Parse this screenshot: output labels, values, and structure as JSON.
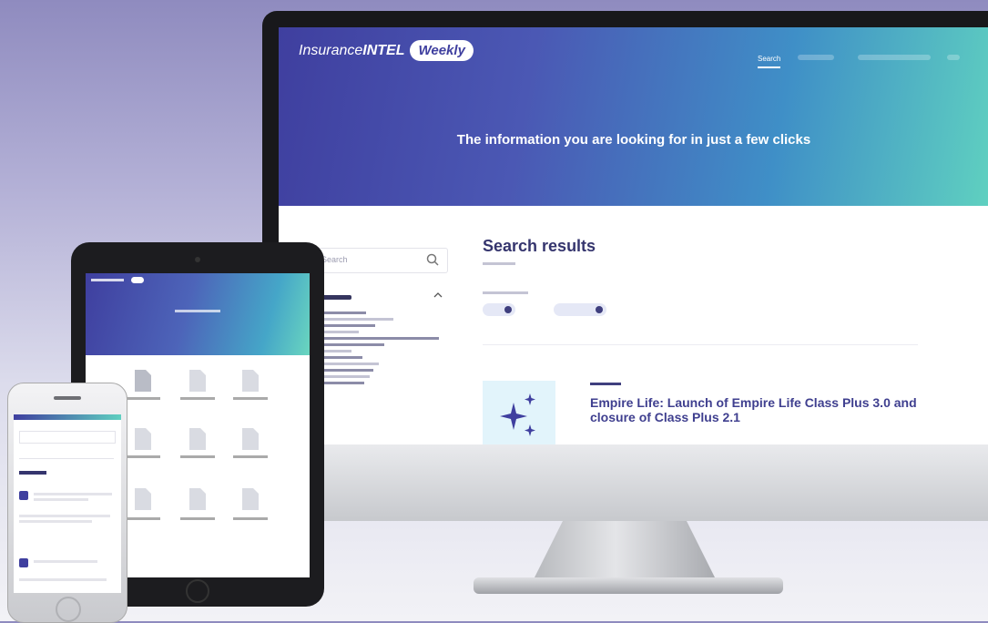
{
  "desktop": {
    "brand": {
      "prefix": "Insurance",
      "bold": "INTEL",
      "badge": "Weekly"
    },
    "nav": {
      "active": "Search"
    },
    "hero": {
      "title": "The information you are looking for in just a few clicks"
    },
    "search": {
      "placeholder": "Search"
    },
    "results": {
      "title": "Search results"
    },
    "card": {
      "title": "Empire Life: Launch of Empire Life Class Plus 3.0 and closure of Class Plus 2.1"
    }
  },
  "colors": {
    "primary": "#3f3f9f",
    "accent": "#5fd0c0",
    "title": "#35356e"
  },
  "icons": [
    "search-icon",
    "sparkle-icon",
    "document-icon",
    "chevron-up-icon",
    "close-icon"
  ]
}
